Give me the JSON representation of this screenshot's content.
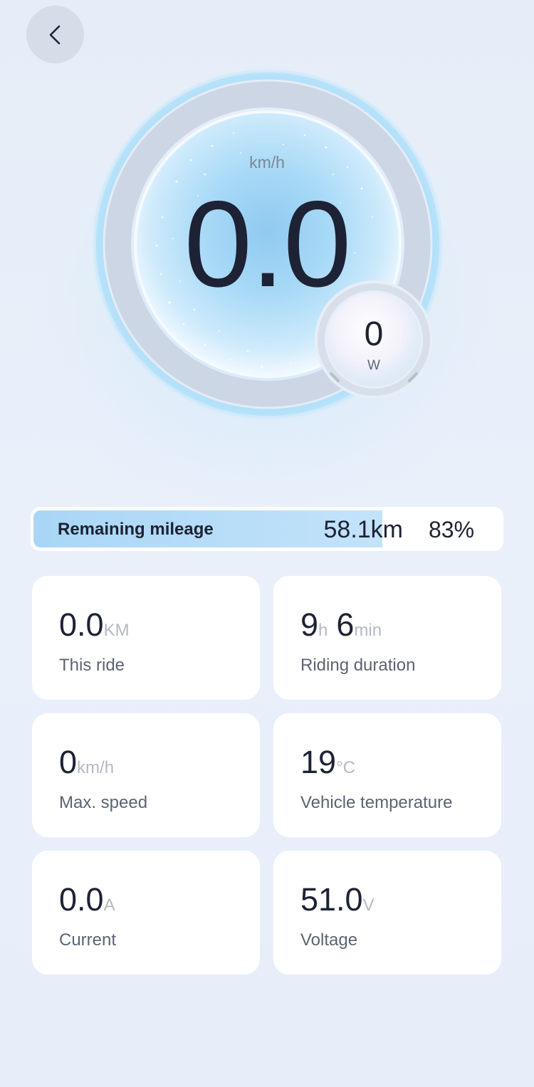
{
  "nav": {
    "back_icon": "chevron-left-icon"
  },
  "speed": {
    "unit": "km/h",
    "value": "0.0"
  },
  "power": {
    "value": "0",
    "unit": "W"
  },
  "battery": {
    "label": "Remaining mileage",
    "mileage": "58.1km",
    "percent_text": "83%",
    "percent": 83
  },
  "stats": {
    "this_ride": {
      "value": "0.0",
      "unit": "KM",
      "label": "This ride"
    },
    "riding_duration": {
      "hours": "9",
      "hours_unit": "h",
      "minutes": "6",
      "minutes_unit": "min",
      "label": "Riding duration"
    },
    "max_speed": {
      "value": "0",
      "unit": "km/h",
      "label": "Max. speed"
    },
    "vehicle_temperature": {
      "value": "19",
      "unit": "°C",
      "label": "Vehicle temperature"
    },
    "current": {
      "value": "0.0",
      "unit": "A",
      "label": "Current"
    },
    "voltage": {
      "value": "51.0",
      "unit": "V",
      "label": "Voltage"
    }
  },
  "colors": {
    "background": "#e7eef9",
    "accent_blue": "#a9d6f6",
    "text_dark": "#1d2234",
    "text_muted": "#5c6373",
    "unit_gray": "#b3b9c4"
  }
}
